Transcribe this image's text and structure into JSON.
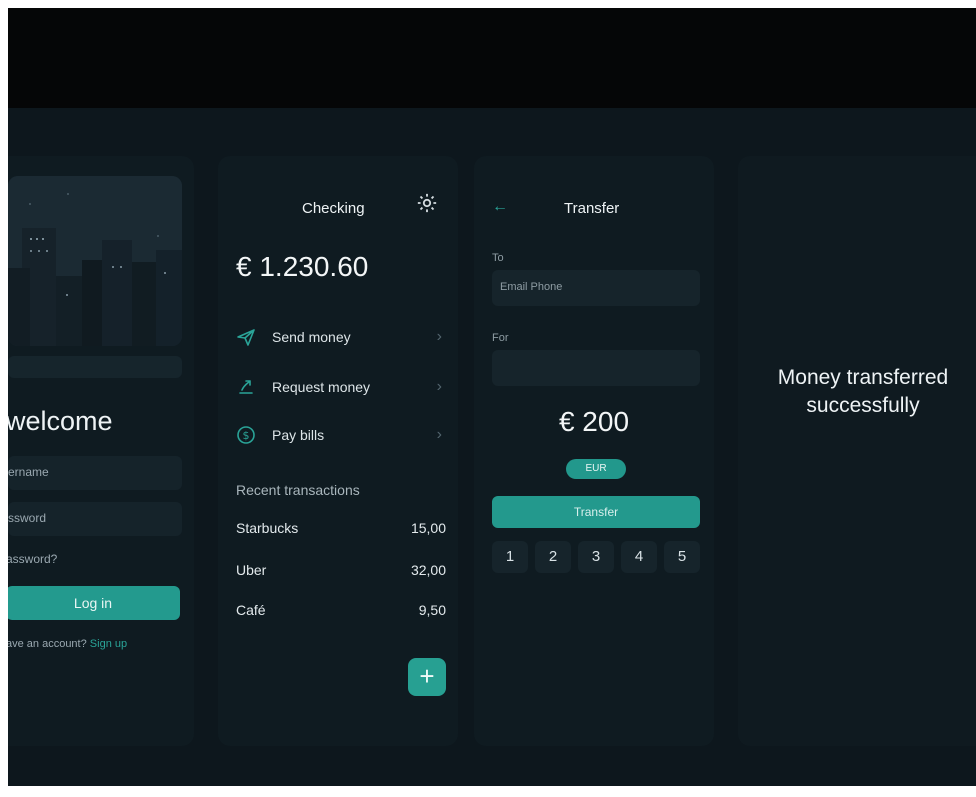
{
  "login": {
    "welcome": "welcome",
    "username_placeholder": "ername",
    "password_placeholder": "ssword",
    "forgot_password": "assword?",
    "login_button": "Log in",
    "signup_prompt": "ave an account?",
    "signup_link": "Sign up"
  },
  "checking": {
    "title": "Checking",
    "balance": "€ 1.230.60",
    "menu": [
      {
        "icon": "send-icon",
        "label": "Send money"
      },
      {
        "icon": "request-icon",
        "label": "Request money"
      },
      {
        "icon": "dollar-coin-icon",
        "label": "Pay bills"
      }
    ],
    "recent_title": "Recent transactions",
    "transactions": [
      {
        "name": "Starbucks",
        "amount": "15,00"
      },
      {
        "name": "Uber",
        "amount": "32,00"
      },
      {
        "name": "Café",
        "amount": "9,50"
      }
    ],
    "add_label": "+"
  },
  "transfer": {
    "title": "Transfer",
    "to_label": "To",
    "to_placeholder": "Email Phone",
    "for_label": "For",
    "for_placeholder": "",
    "amount": "€ 200",
    "currency": "EUR",
    "transfer_button": "Transfer",
    "keypad": [
      "1",
      "2",
      "3",
      "4",
      "5"
    ]
  },
  "success": {
    "line1": "Money transferred",
    "line2": "successfully"
  },
  "colors": {
    "accent": "#27a092",
    "background": "#0d171d",
    "panel": "#0f1b21"
  }
}
